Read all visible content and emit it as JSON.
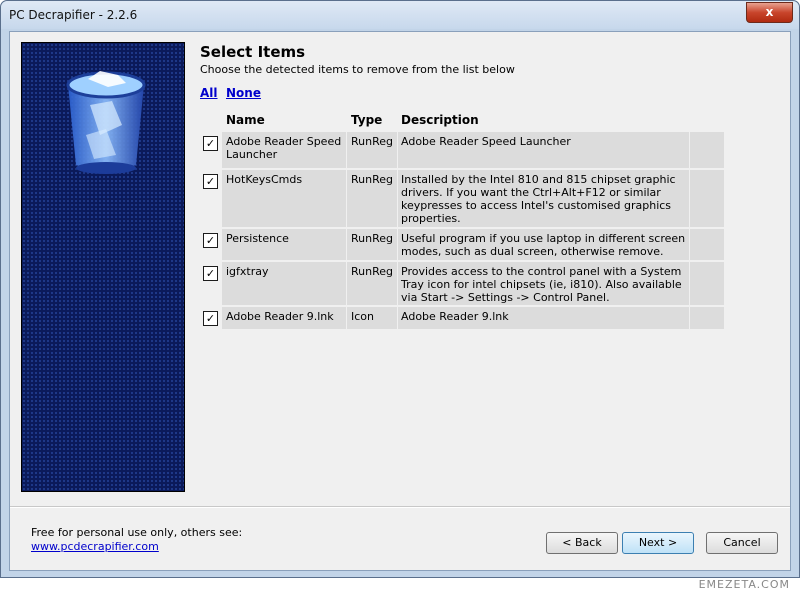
{
  "window": {
    "title": "PC Decrapifier - 2.2.6",
    "close_label": "x"
  },
  "main": {
    "heading": "Select Items",
    "subheading": "Choose the detected items to remove from the list below",
    "select_all_label": "All",
    "select_none_label": "None",
    "columns": {
      "name": "Name",
      "type": "Type",
      "description": "Description"
    },
    "rows": [
      {
        "checked": true,
        "name": "Adobe Reader Speed Launcher",
        "type": "RunReg",
        "description": "Adobe Reader Speed Launcher"
      },
      {
        "checked": true,
        "name": "HotKeysCmds",
        "type": "RunReg",
        "description": "Installed by the Intel 810 and 815 chipset graphic drivers. If you want the Ctrl+Alt+F12 or similar keypresses to access Intel's customised graphics properties."
      },
      {
        "checked": true,
        "name": "Persistence",
        "type": "RunReg",
        "description": "Useful program if you use laptop in different screen modes, such as dual screen, otherwise remove."
      },
      {
        "checked": true,
        "name": "igfxtray",
        "type": "RunReg",
        "description": "Provides access to the control panel with a System Tray icon for intel chipsets (ie, i810). Also available via Start -> Settings -> Control Panel."
      },
      {
        "checked": true,
        "name": "Adobe Reader 9.lnk",
        "type": "Icon",
        "description": "Adobe Reader 9.lnk"
      }
    ]
  },
  "footer": {
    "text": "Free for personal use only, others see:",
    "link": "www.pcdecrapifier.com",
    "back_label": "< Back",
    "next_label": "Next >",
    "cancel_label": "Cancel"
  },
  "watermark": "EMEZETA.COM",
  "icons": {
    "sidebar": "recycle-bin-icon",
    "check": "checkmark-icon"
  }
}
